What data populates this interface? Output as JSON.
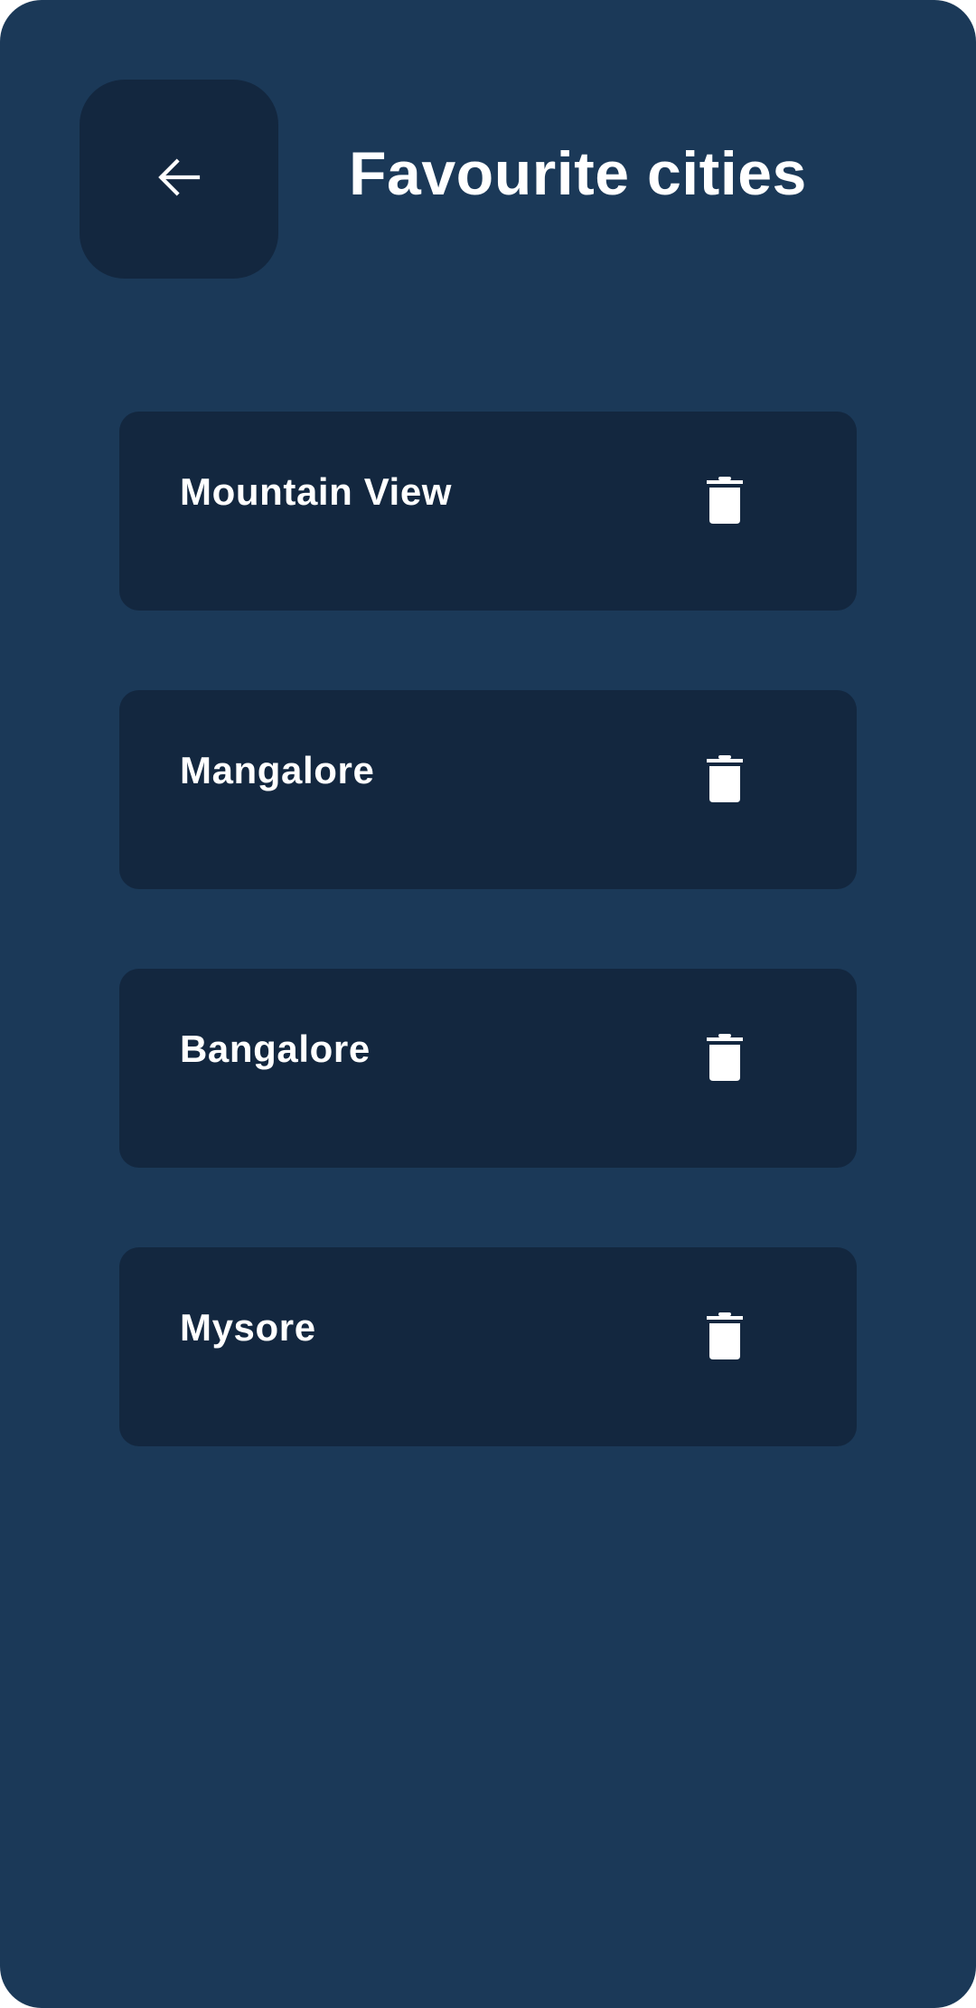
{
  "header": {
    "title": "Favourite cities",
    "back_icon": "arrow-left-icon"
  },
  "cities": [
    {
      "name": "Mountain View",
      "delete_icon": "trash-icon"
    },
    {
      "name": "Mangalore",
      "delete_icon": "trash-icon"
    },
    {
      "name": "Bangalore",
      "delete_icon": "trash-icon"
    },
    {
      "name": "Mysore",
      "delete_icon": "trash-icon"
    }
  ],
  "colors": {
    "background": "#1b3958",
    "card": "#13273f",
    "text": "#ffffff"
  }
}
